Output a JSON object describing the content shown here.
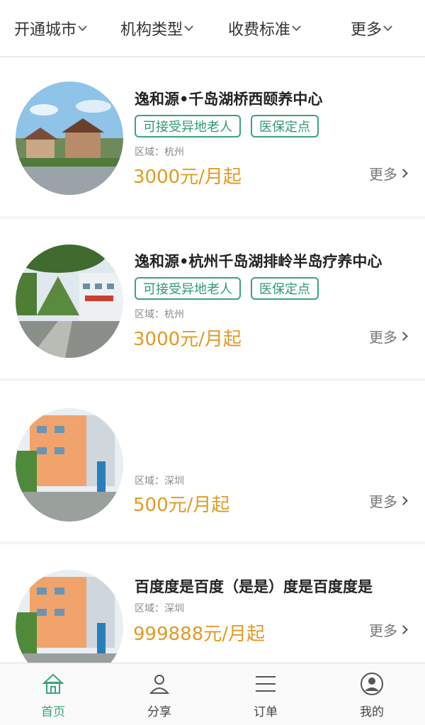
{
  "filters": [
    {
      "label": "开通城市"
    },
    {
      "label": "机构类型"
    },
    {
      "label": "收费标准"
    },
    {
      "label": "更多"
    }
  ],
  "cards": [
    {
      "title": "逸和源•千岛湖桥西颐养中心",
      "tags": [
        "可接受异地老人",
        "医保定点"
      ],
      "region": "区域：杭州",
      "price": "3000元/月起",
      "more": "更多"
    },
    {
      "title": "逸和源•杭州千岛湖排岭半岛疗养中心",
      "tags": [
        "可接受异地老人",
        "医保定点"
      ],
      "region": "区域：杭州",
      "price": "3000元/月起",
      "more": "更多"
    },
    {
      "title": "",
      "tags": [],
      "region": "区域：深圳",
      "price": "500元/月起",
      "more": "更多"
    },
    {
      "title": "百度度是百度（是是）度是百度度是",
      "tags": [],
      "region": "区域：深圳",
      "price": "999888元/月起",
      "more": "更多"
    }
  ],
  "tabs": [
    {
      "label": "首页",
      "icon": "home-icon",
      "active": true
    },
    {
      "label": "分享",
      "icon": "person-icon",
      "active": false
    },
    {
      "label": "订单",
      "icon": "menu-lines-icon",
      "active": false
    },
    {
      "label": "我的",
      "icon": "user-circle-icon",
      "active": false
    }
  ],
  "colors": {
    "accent": "#3aa57a",
    "price": "#e09b24"
  }
}
